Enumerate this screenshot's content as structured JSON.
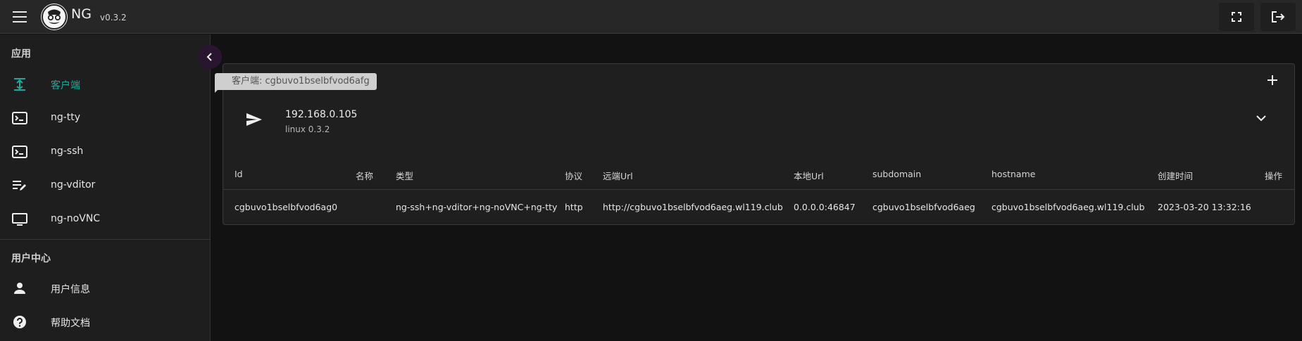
{
  "header": {
    "app_name": "NG",
    "version": "v0.3.2",
    "menu_icon": "hamburger-icon",
    "logo": "ng-logo",
    "fullscreen_icon": "fullscreen-icon",
    "logout_icon": "logout-icon"
  },
  "sidebar": {
    "section_apps": "应用",
    "apps": [
      {
        "label": "客户端",
        "icon": "upload-icon",
        "active": true
      },
      {
        "label": "ng-tty",
        "icon": "terminal-icon"
      },
      {
        "label": "ng-ssh",
        "icon": "terminal-icon"
      },
      {
        "label": "ng-vditor",
        "icon": "edit-note-icon"
      },
      {
        "label": "ng-noVNC",
        "icon": "monitor-icon"
      }
    ],
    "section_user": "用户中心",
    "user": [
      {
        "label": "用户信息",
        "icon": "person-icon"
      },
      {
        "label": "帮助文档",
        "icon": "help-icon"
      }
    ],
    "collapse_icon": "chevron-left-icon"
  },
  "tooltip": "客户端: cgbuvo1bselbfvod6afg",
  "client": {
    "host": "192.168.0.105",
    "os": "linux 0.3.2",
    "send_icon": "send-icon",
    "expand_icon": "chevron-down-icon",
    "add_icon": "plus-icon"
  },
  "table": {
    "headers": [
      "Id",
      "名称",
      "类型",
      "协议",
      "远端Url",
      "本地Url",
      "subdomain",
      "hostname",
      "创建时间",
      "操作"
    ],
    "rows": [
      [
        "cgbuvo1bselbfvod6ag0",
        "",
        "ng-ssh+ng-vditor+ng-noVNC+ng-tty",
        "http",
        "http://cgbuvo1bselbfvod6aeg.wl119.club",
        "0.0.0.0:46847",
        "cgbuvo1bselbfvod6aeg",
        "cgbuvo1bselbfvod6aeg.wl119.club",
        "2023-03-20 13:32:16",
        ""
      ]
    ]
  },
  "colors": {
    "accent": "#26a69a",
    "background": "#121212",
    "surface": "#1f1f1f"
  }
}
